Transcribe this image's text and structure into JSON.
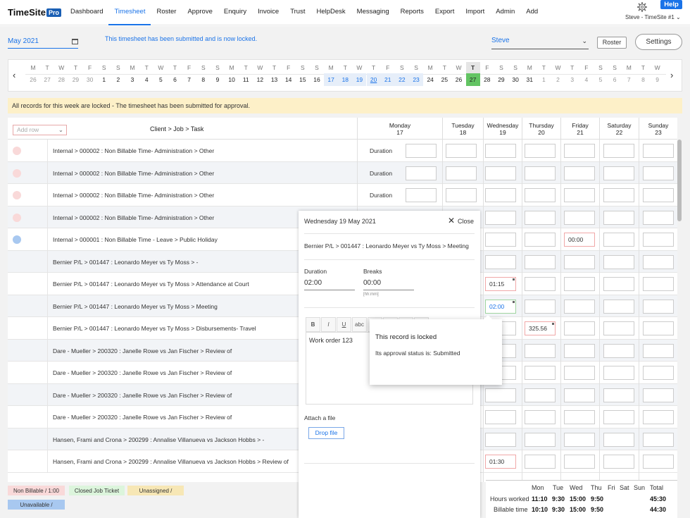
{
  "app": {
    "logo": "TimeSite",
    "logo_badge": "Pro",
    "help": "Help",
    "user": "Steve - TimeSite #1"
  },
  "nav": [
    "Dashboard",
    "Timesheet",
    "Roster",
    "Approve",
    "Enquiry",
    "Invoice",
    "Trust",
    "HelpDesk",
    "Messaging",
    "Reports",
    "Export",
    "Import",
    "Admin",
    "Add"
  ],
  "nav_active": "Timesheet",
  "header": {
    "month": "May 2021",
    "locked_message": "This timesheet has been submitted and is now locked.",
    "employee": "Steve",
    "roster_label": "Roster",
    "settings_label": "Settings"
  },
  "strip": {
    "weekdays": [
      "M",
      "T",
      "W",
      "T",
      "F",
      "S",
      "S",
      "M",
      "T",
      "W",
      "T",
      "F",
      "S",
      "S",
      "M",
      "T",
      "W",
      "T",
      "F",
      "S",
      "S",
      "M",
      "T",
      "W",
      "T",
      "F",
      "S",
      "S",
      "M",
      "T",
      "W",
      "T",
      "F",
      "S",
      "S",
      "M",
      "T",
      "W",
      "T",
      "F",
      "S",
      "S",
      "M",
      "T",
      "W"
    ],
    "dates": [
      "26",
      "27",
      "28",
      "29",
      "30",
      "1",
      "2",
      "3",
      "4",
      "5",
      "6",
      "7",
      "8",
      "9",
      "10",
      "11",
      "12",
      "13",
      "14",
      "15",
      "16",
      "17",
      "18",
      "19",
      "20",
      "21",
      "22",
      "23",
      "24",
      "25",
      "26",
      "27",
      "28",
      "29",
      "30",
      "31",
      "1",
      "2",
      "3",
      "4",
      "5",
      "6",
      "7",
      "8",
      "9"
    ]
  },
  "banner": "All records for this week are locked - The timesheet has been submitted for approval.",
  "grid": {
    "add_row_placeholder": "Add row",
    "column_title": "Client > Job > Task",
    "days": [
      {
        "name": "Monday",
        "num": "17"
      },
      {
        "name": "Tuesday",
        "num": "18"
      },
      {
        "name": "Wednesday",
        "num": "19"
      },
      {
        "name": "Thursday",
        "num": "20"
      },
      {
        "name": "Friday",
        "num": "21"
      },
      {
        "name": "Saturday",
        "num": "22"
      },
      {
        "name": "Sunday",
        "num": "23"
      }
    ],
    "duration_label": "Duration",
    "rows": [
      {
        "label": "Internal > 000002 : Non Billable Time- Administration > Other",
        "dot": "pink",
        "duration": true
      },
      {
        "label": "Internal > 000002 : Non Billable Time- Administration > Other",
        "dot": "pink",
        "duration": true
      },
      {
        "label": "Internal > 000002 : Non Billable Time- Administration > Other",
        "dot": "pink",
        "duration": true
      },
      {
        "label": "Internal > 000002 : Non Billable Time- Administration > Other",
        "dot": "pink"
      },
      {
        "label": "Internal > 000001 : Non Billable Time - Leave > Public Holiday",
        "dot": "blue"
      },
      {
        "label": "Bernier P/L > 001447 : Leonardo Meyer vs Ty Moss > -"
      },
      {
        "label": "Bernier P/L > 001447 : Leonardo Meyer vs Ty Moss > Attendance at Court"
      },
      {
        "label": "Bernier P/L > 001447 : Leonardo Meyer vs Ty Moss > Meeting"
      },
      {
        "label": "Bernier P/L > 001447 : Leonardo Meyer vs Ty Moss > Disbursements- Travel"
      },
      {
        "label": "Dare - Mueller > 200320 : Janelle Rowe vs Jan Fischer > Review of"
      },
      {
        "label": "Dare - Mueller > 200320 : Janelle Rowe vs Jan Fischer > Review of"
      },
      {
        "label": "Dare - Mueller > 200320 : Janelle Rowe vs Jan Fischer > Review of"
      },
      {
        "label": "Dare - Mueller > 200320 : Janelle Rowe vs Jan Fischer > Review of"
      },
      {
        "label": "Hansen, Frami and Crona > 200299 : Annalise Villanueva vs Jackson Hobbs > -"
      },
      {
        "label": "Hansen, Frami and Crona > 200299 : Annalise Villanueva vs Jackson Hobbs > Review of"
      }
    ],
    "cell_values": {
      "r4_fri": "00:00",
      "r6_wed": "01:15",
      "r7_wed": "02:00",
      "r8_thu": "325.56",
      "r14_wed": "01:30"
    }
  },
  "legend": [
    {
      "label": "Non Billable / 1:00",
      "color": "#f9d9d9"
    },
    {
      "label": "Closed Job Ticket",
      "color": "#dcf5dc"
    },
    {
      "label": "Unassigned /",
      "color": "#f7e7b5"
    },
    {
      "label": "Unavailable /",
      "color": "#a8c8f0"
    }
  ],
  "summary": {
    "heads": [
      "Mon",
      "Tue",
      "Wed",
      "Thu",
      "Fri",
      "Sat",
      "Sun",
      "Total"
    ],
    "hours_label": "Hours worked",
    "hours": [
      "11:10",
      "9:30",
      "15:00",
      "9:50",
      "",
      "",
      "",
      "45:30"
    ],
    "billable_label": "Billable time",
    "billable": [
      "10:10",
      "9:30",
      "15:00",
      "9:50",
      "",
      "",
      "",
      "44:30"
    ]
  },
  "panel": {
    "date": "Wednesday 19 May 2021",
    "close": "Close",
    "task": "Bernier P/L > 001447 : Leonardo Meyer vs Ty Moss > Meeting",
    "duration_label": "Duration",
    "duration": "02:00",
    "breaks_label": "Breaks",
    "breaks": "00:00",
    "hint": "[hh:mm]",
    "toolbar": [
      "B",
      "I",
      "U",
      "abc"
    ],
    "notes": "Work order 123",
    "attach_label": "Attach a file",
    "drop_label": "Drop file"
  },
  "popup": {
    "title": "This record is locked",
    "message": "Its approval status is: Submitted"
  }
}
